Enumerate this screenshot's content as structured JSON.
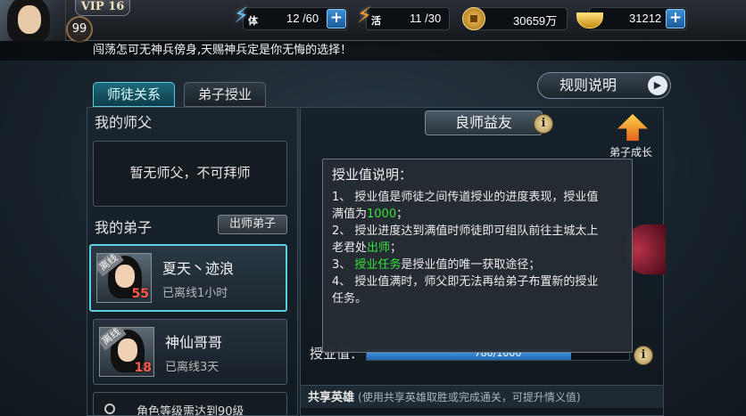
{
  "player": {
    "vip": "VIP 16",
    "level": "99"
  },
  "resources": {
    "stamina": {
      "icon_label": "体",
      "value": "12 /60"
    },
    "vigor": {
      "icon_label": "活",
      "value": "11 /30"
    },
    "coins": {
      "value": "30659万"
    },
    "gold": {
      "value": "31212"
    }
  },
  "ticker": {
    "text": "闯荡怎可无神兵傍身,天赐神兵定是你无悔的选择！"
  },
  "tabs": [
    {
      "label": "师徒关系",
      "active": true
    },
    {
      "label": "弟子授业",
      "active": false
    }
  ],
  "rules_button": {
    "label": "规则说明"
  },
  "left": {
    "master_title": "我的师父",
    "no_master_text": "暂无师父，不可拜师",
    "disciples_title": "我的弟子",
    "graduate_button": "出师弟子",
    "disciples": [
      {
        "name": "夏天丶迹浪",
        "level": "55",
        "status": "已离线1小时",
        "tag": "离线"
      },
      {
        "name": "神仙哥哥",
        "level": "18",
        "status": "已离线3天",
        "tag": "离线"
      }
    ],
    "bottom_hint": "角色等级需达到90级"
  },
  "right": {
    "header": "良师益友",
    "growth_label": "弟子成长",
    "progress": {
      "label": "授业值：",
      "text": "780/1000",
      "current": 780,
      "max": 1000
    },
    "shared": {
      "title": "共享英雄",
      "note": "(使用共享英雄取胜或完成通关，可提升情义值)"
    }
  },
  "tooltip": {
    "title": "授业值说明：",
    "line1_a": "1、 授业值是师徒之间传道授业的进度表现，授业值",
    "line1_b": "满值为",
    "line1_hl": "1000",
    "line1_c": "；",
    "line2_a": "2、 授业进度达到满值时师徒即可组队前往主城太上",
    "line2_b": "老君处",
    "line2_hl": "出师",
    "line2_c": "；",
    "line3_a": "3、 ",
    "line3_hl": "授业任务",
    "line3_b": "是授业值的唯一获取途径；",
    "line4_a": "4、 授业值满时，师父即无法再给弟子布置新的授业",
    "line4_b": "任务。"
  },
  "colors": {
    "highlight_green": "#35e23a",
    "active_tab": "#1d6a7b",
    "selected_card_border": "#58d0e2",
    "level_red": "#ff5a4a",
    "progress_blue": "#4fa6f0"
  },
  "icons": {
    "stamina": "lightning-bolt-icon",
    "vigor": "fire-bolt-icon",
    "coins": "copper-coin-icon",
    "gold": "gold-ingot-icon",
    "info": "info-icon",
    "growth": "arrow-up-flame-icon",
    "rules": "play-arrow-icon"
  }
}
